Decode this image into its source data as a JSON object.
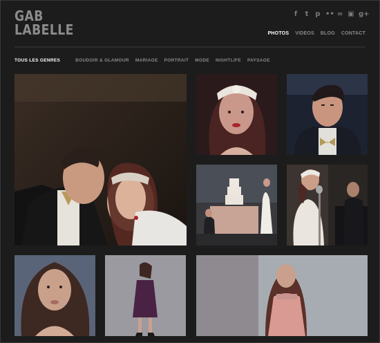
{
  "brand": {
    "line1": "GAB",
    "line2": "LABELLE"
  },
  "social_icons": [
    {
      "name": "facebook-icon",
      "glyph": "f"
    },
    {
      "name": "twitter-icon",
      "glyph": "t"
    },
    {
      "name": "pinterest-icon",
      "glyph": "p"
    },
    {
      "name": "flickr-icon",
      "glyph": "••"
    },
    {
      "name": "infinity-icon",
      "glyph": "∞"
    },
    {
      "name": "instagram-icon",
      "glyph": "▣"
    },
    {
      "name": "google-plus-icon",
      "glyph": "g+"
    }
  ],
  "nav": {
    "photos": "PHOTOS",
    "videos": "VIDEOS",
    "blog": "BLOG",
    "contact": "CONTACT"
  },
  "filters": {
    "all": "TOUS LES GENRES",
    "boudoir": "BOUDOIR & GLAMOUR",
    "mariage": "MARIAGE",
    "portrait": "PORTRAIT",
    "mode": "MODE",
    "nightlife": "NIGHTLIFE",
    "paysage": "PAYSAGE"
  },
  "colors": {
    "background": "#1c1c1c",
    "active": "#ffffff",
    "muted": "#8a8a8a"
  },
  "gallery": [
    {
      "subject": "couple-portrait"
    },
    {
      "subject": "bride-headband-portrait"
    },
    {
      "subject": "groom-portrait"
    },
    {
      "subject": "wedding-cake-scene"
    },
    {
      "subject": "bride-singing-microphone"
    },
    {
      "subject": "woman-portrait"
    },
    {
      "subject": "woman-purple-dress"
    },
    {
      "subject": "woman-pink-dress"
    }
  ]
}
